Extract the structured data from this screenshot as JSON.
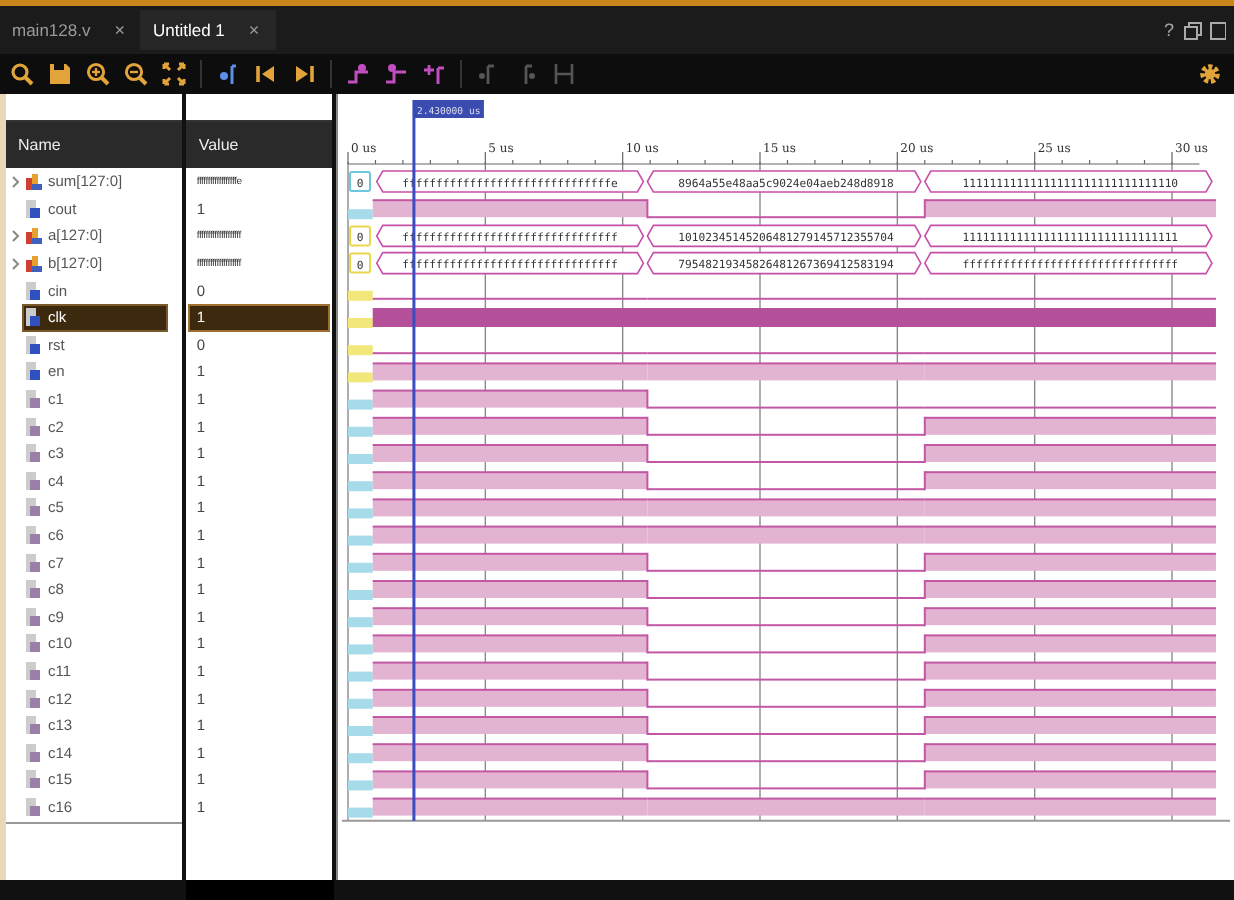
{
  "tabs": [
    {
      "label": "main128.v",
      "close": "×",
      "selected": false
    },
    {
      "label": "Untitled 1",
      "close": "×",
      "selected": true
    }
  ],
  "window_controls": {
    "help": "?"
  },
  "toolbar": [
    {
      "kind": "search",
      "enabled": true
    },
    {
      "kind": "save",
      "enabled": true
    },
    {
      "kind": "zoom-in",
      "enabled": true
    },
    {
      "kind": "zoom-out",
      "enabled": true
    },
    {
      "kind": "fit",
      "enabled": true
    },
    {
      "kind": "go-cursor",
      "enabled": true
    },
    {
      "kind": "first",
      "enabled": true
    },
    {
      "kind": "last",
      "enabled": true
    },
    {
      "kind": "prev-edge",
      "enabled": true
    },
    {
      "kind": "next-edge",
      "enabled": true
    },
    {
      "kind": "add-marker",
      "enabled": true
    },
    {
      "kind": "prev-marker",
      "enabled": false
    },
    {
      "kind": "next-marker",
      "enabled": false
    },
    {
      "kind": "swap",
      "enabled": false
    }
  ],
  "columns": [
    "Name",
    "Value"
  ],
  "cursor": {
    "label": "2.430000 us",
    "level": 0.08
  },
  "ticks": [
    "0 us",
    "5 us",
    "10 us",
    "15 us",
    "20 us",
    "25 us",
    "30 us"
  ],
  "signals": [
    {
      "name": "sum[127:0]",
      "kind": "bus",
      "color": "#6cc6dc",
      "expandable": true,
      "selected": false,
      "value": "ffffffffffffffffffe",
      "initial": "0",
      "segments": [
        "fffffffffffffffffffffffffffffffe",
        "8964a55e48aa5c9024e04aeb248d8918",
        "11111111111111111111111111111110"
      ]
    },
    {
      "name": "cout",
      "kind": "bit",
      "color": "#a6dce9",
      "selected": false,
      "value": "1",
      "segments": [
        true,
        false,
        true
      ]
    },
    {
      "name": "a[127:0]",
      "kind": "bus",
      "color": "#e8d84a",
      "expandable": true,
      "selected": false,
      "value": "ffffffffffffffffffff",
      "initial": "0",
      "segments": [
        "ffffffffffffffffffffffffffffffff",
        "10102345145206481279145712355704",
        "11111111111111111111111111111111"
      ]
    },
    {
      "name": "b[127:0]",
      "kind": "bus",
      "color": "#e8d84a",
      "expandable": true,
      "selected": false,
      "value": "ffffffffffffffffffff",
      "initial": "0",
      "segments": [
        "ffffffffffffffffffffffffffffffff",
        "79548219345826481267369412583194",
        "ffffffffffffffffffffffffffffffff"
      ]
    },
    {
      "name": "cin",
      "kind": "bit",
      "color": "#f2e77a",
      "selected": false,
      "value": "0",
      "segments": [
        false,
        false,
        false
      ]
    },
    {
      "name": "clk",
      "kind": "clock",
      "color": "#f2e77a",
      "selected": true,
      "value": "1"
    },
    {
      "name": "rst",
      "kind": "bit",
      "color": "#f2e77a",
      "selected": false,
      "value": "0",
      "segments": [
        false,
        false,
        false
      ]
    },
    {
      "name": "en",
      "kind": "bit",
      "color": "#f2e77a",
      "selected": false,
      "value": "1",
      "segments": [
        true,
        true,
        true
      ]
    },
    {
      "name": "c1",
      "kind": "net",
      "color": "#a6dce9",
      "selected": false,
      "value": "1",
      "segments": [
        true,
        false,
        false
      ]
    },
    {
      "name": "c2",
      "kind": "net",
      "color": "#a6dce9",
      "selected": false,
      "value": "1",
      "segments": [
        true,
        false,
        true
      ]
    },
    {
      "name": "c3",
      "kind": "net",
      "color": "#a6dce9",
      "selected": false,
      "value": "1",
      "segments": [
        true,
        false,
        true
      ]
    },
    {
      "name": "c4",
      "kind": "net",
      "color": "#a6dce9",
      "selected": false,
      "value": "1",
      "segments": [
        true,
        false,
        true
      ]
    },
    {
      "name": "c5",
      "kind": "net",
      "color": "#a6dce9",
      "selected": false,
      "value": "1",
      "segments": [
        true,
        true,
        true
      ]
    },
    {
      "name": "c6",
      "kind": "net",
      "color": "#a6dce9",
      "selected": false,
      "value": "1",
      "segments": [
        true,
        true,
        true
      ]
    },
    {
      "name": "c7",
      "kind": "net",
      "color": "#a6dce9",
      "selected": false,
      "value": "1",
      "segments": [
        true,
        false,
        true
      ]
    },
    {
      "name": "c8",
      "kind": "net",
      "color": "#a6dce9",
      "selected": false,
      "value": "1",
      "segments": [
        true,
        false,
        true
      ]
    },
    {
      "name": "c9",
      "kind": "net",
      "color": "#a6dce9",
      "selected": false,
      "value": "1",
      "segments": [
        true,
        false,
        true
      ]
    },
    {
      "name": "c10",
      "kind": "net",
      "color": "#a6dce9",
      "selected": false,
      "value": "1",
      "segments": [
        true,
        false,
        true
      ]
    },
    {
      "name": "c11",
      "kind": "net",
      "color": "#a6dce9",
      "selected": false,
      "value": "1",
      "segments": [
        true,
        false,
        true
      ]
    },
    {
      "name": "c12",
      "kind": "net",
      "color": "#a6dce9",
      "selected": false,
      "value": "1",
      "segments": [
        true,
        false,
        true
      ]
    },
    {
      "name": "c13",
      "kind": "net",
      "color": "#a6dce9",
      "selected": false,
      "value": "1",
      "segments": [
        true,
        false,
        true
      ]
    },
    {
      "name": "c14",
      "kind": "net",
      "color": "#a6dce9",
      "selected": false,
      "value": "1",
      "segments": [
        true,
        false,
        true
      ]
    },
    {
      "name": "c15",
      "kind": "net",
      "color": "#a6dce9",
      "selected": false,
      "value": "1",
      "segments": [
        true,
        false,
        true
      ]
    },
    {
      "name": "c16",
      "kind": "net",
      "color": "#a6dce9",
      "selected": false,
      "value": "1",
      "segments": [
        true,
        true,
        true
      ]
    }
  ]
}
